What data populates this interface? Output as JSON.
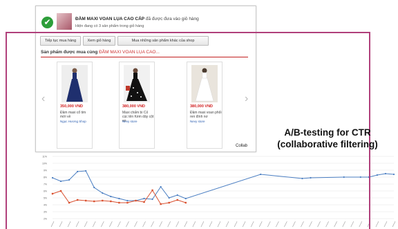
{
  "notice": {
    "product_name": "ĐẦM MAXI VOAN LỤA CAO CẤP",
    "added_text": "đã được đưa vào giỏ hàng",
    "cart_count_text": "Hiện đang có 3 sản phẩm trong giỏ hàng",
    "check_icon": "check-circle-icon",
    "check_color": "#2e9e3a"
  },
  "buttons": {
    "continue_label": "Tiếp tục mua hàng",
    "view_cart_label": "Xem giỏ hàng",
    "shop_more_label": "Mua những sản phẩm khác của shop"
  },
  "section": {
    "title_prefix": "Sản phẩm được mua cùng",
    "title_product": "ĐẦM MAXI VOAN LỤA CAO..."
  },
  "products": [
    {
      "price": "350,000 VND",
      "name": "Đầm maxi cổ tim mới về",
      "shop": "Ngọc Hương Shop"
    },
    {
      "price": "380,000 VND",
      "name": "Maxi chấm bi Cỏ cúc tên Kèm dây cột eo",
      "shop": "Nevy store"
    },
    {
      "price": "380,000 VND",
      "name": "Đầm maxi voan phối ren đính nơ",
      "shop": "Nevy store"
    }
  ],
  "slide_arrows": {
    "prev": "‹",
    "next": "›"
  },
  "headline": {
    "line1": "A/B-testing for CTR",
    "line2": "(collaborative filtering)"
  },
  "colors": {
    "frame": "#b0407b",
    "price": "#d01d1d",
    "blue_series": "#4a7ec2",
    "red_series": "#d9502f"
  },
  "chart_data": {
    "type": "line",
    "series_label": "Collab",
    "x_count": 42,
    "y_ticks": [
      "11%",
      "10%",
      "9%",
      "8%",
      "7%",
      "6%",
      "5%",
      "4%",
      "3%",
      "2%"
    ],
    "ylim": [
      2,
      11
    ],
    "series": [
      {
        "name": "Collab",
        "values": [
          7.9,
          7.4,
          7.6,
          8.8,
          8.9,
          6.5,
          5.7,
          5.2,
          4.9,
          4.6,
          4.6,
          4.9,
          4.8,
          6.6,
          5.0,
          5.4,
          4.9,
          null,
          null,
          null,
          null,
          null,
          null,
          null,
          null,
          8.4,
          null,
          null,
          null,
          null,
          7.8,
          7.9,
          null,
          null,
          null,
          8.0,
          null,
          8.0,
          8.0,
          8.3,
          8.5,
          8.4
        ]
      },
      {
        "values": [
          5.6,
          6.0,
          4.3,
          4.7,
          4.6,
          4.5,
          4.6,
          4.5,
          4.3,
          4.3,
          4.6,
          4.4,
          6.1,
          4.1,
          4.3,
          4.7,
          4.3
        ]
      }
    ]
  }
}
